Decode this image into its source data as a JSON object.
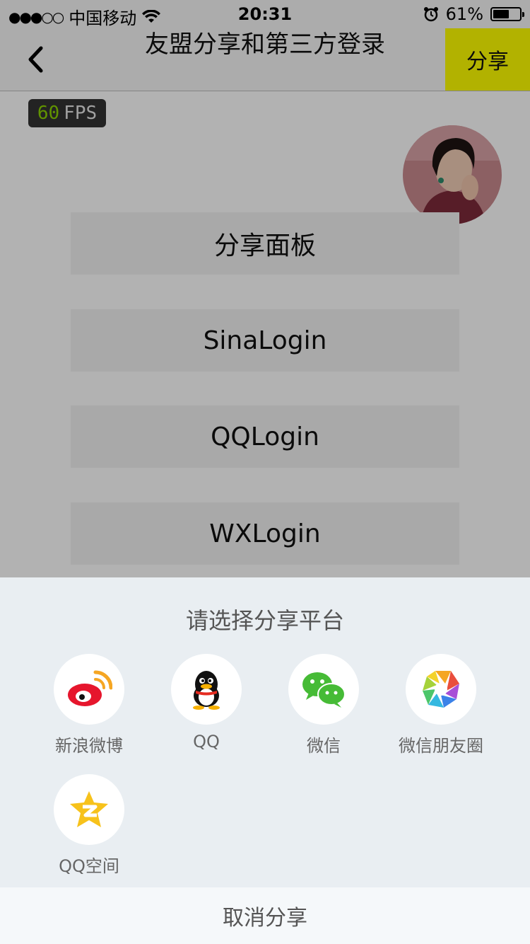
{
  "status_bar": {
    "signal": "●●●○○",
    "carrier": "中国移动",
    "time": "20:31",
    "battery": "61%",
    "battery_level": 0.61
  },
  "nav": {
    "title": "友盟分享和第三方登录",
    "share_label": "分享"
  },
  "fps": {
    "value": "60",
    "unit": "FPS"
  },
  "buttons": [
    {
      "label": "分享面板"
    },
    {
      "label": "SinaLogin"
    },
    {
      "label": "QQLogin"
    },
    {
      "label": "WXLogin"
    }
  ],
  "share_panel": {
    "title": "请选择分享平台",
    "platforms": [
      {
        "label": "新浪微博",
        "icon": "weibo-icon"
      },
      {
        "label": "QQ",
        "icon": "qq-icon"
      },
      {
        "label": "微信",
        "icon": "wechat-icon"
      },
      {
        "label": "微信朋友圈",
        "icon": "moments-icon"
      },
      {
        "label": "QQ空间",
        "icon": "qzone-icon"
      }
    ],
    "cancel_label": "取消分享"
  },
  "colors": {
    "accent": "#ffff00",
    "panel_bg": "#e9eef2",
    "fps_green": "#8bd300"
  }
}
